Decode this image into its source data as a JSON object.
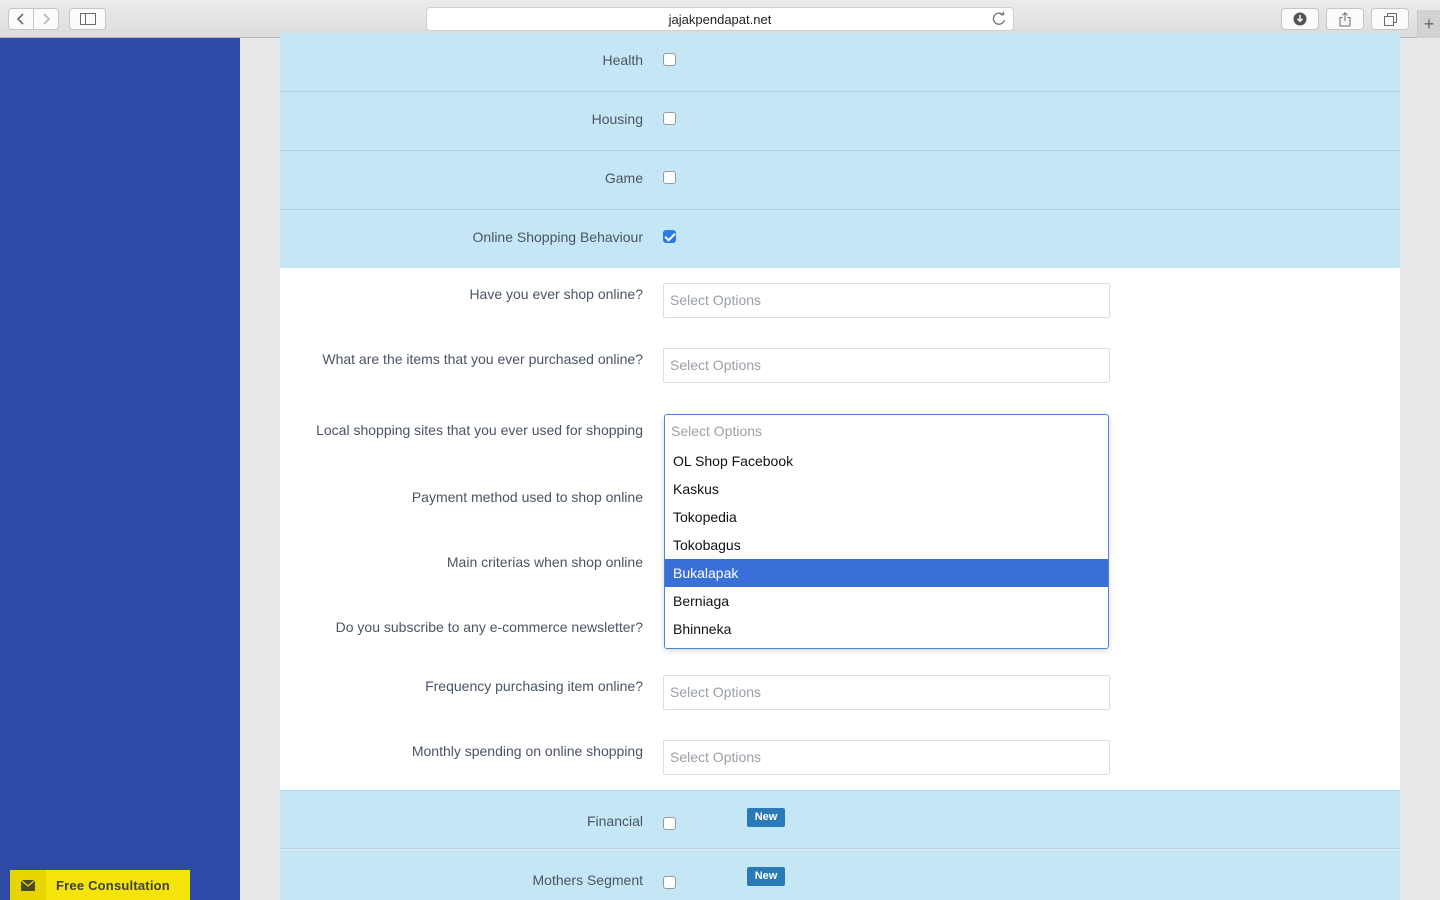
{
  "browser": {
    "url": "jajakpendapat.net"
  },
  "categories": [
    {
      "label": "Health",
      "checked": false
    },
    {
      "label": "Housing",
      "checked": false
    },
    {
      "label": "Game",
      "checked": false
    },
    {
      "label": "Online Shopping Behaviour",
      "checked": true
    }
  ],
  "questions": [
    {
      "label": "Have you ever shop online?",
      "placeholder": "Select Options"
    },
    {
      "label": "What are the items that you ever purchased online?",
      "placeholder": "Select Options"
    },
    {
      "label": "Local shopping sites that you ever used for shopping",
      "placeholder": "Select Options"
    },
    {
      "label": "Payment method used to shop online",
      "placeholder": "Select Options"
    },
    {
      "label": "Main criterias when shop online",
      "placeholder": "Select Options"
    },
    {
      "label": "Do you subscribe to any e-commerce newsletter?",
      "placeholder": "Select Options"
    },
    {
      "label": "Frequency purchasing item online?",
      "placeholder": "Select Options"
    },
    {
      "label": "Monthly spending on online shopping",
      "placeholder": "Select Options"
    }
  ],
  "dropdown": {
    "placeholder": "Select Options",
    "options": [
      "OL Shop Facebook",
      "Kaskus",
      "Tokopedia",
      "Tokobagus",
      "Bukalapak",
      "Berniaga",
      "Bhinneka"
    ],
    "highlighted": "Bukalapak"
  },
  "bottom_categories": [
    {
      "label": "Financial",
      "checked": false,
      "badge": "New"
    },
    {
      "label": "Mothers Segment",
      "checked": false,
      "badge": "New"
    }
  ],
  "consult": {
    "label": "Free Consultation"
  },
  "colors": {
    "sidebar": "#2d4aa8",
    "row_blue": "#c5e6f5",
    "badge": "#2a7ab8",
    "highlight": "#3a6fd8",
    "consult": "#f4e40a"
  }
}
